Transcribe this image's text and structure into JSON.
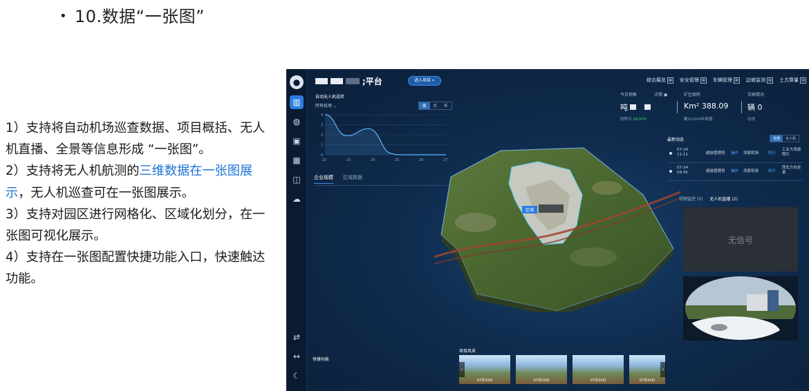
{
  "slide": {
    "title": "10.数据“一张图”",
    "points": [
      "1）支持将自动机场巡查数据、项目概括、无人机直播、全景等信息形成 “一张图”。",
      {
        "before": "2）支持将无人机航测的",
        "highlight": "三维数据在一张图展示",
        "after": "，无人机巡查可在一张图展示。"
      },
      "3）支持对园区进行网格化、区域化划分，在一张图可视化展示。",
      "4）支持在一张图配置快捷功能入口，快速触达功能。"
    ],
    "highlight_color": "#1f74d6"
  },
  "dashboard": {
    "brand_suffix": ";平台",
    "enter_button": "进入项目 »",
    "nav": [
      "综合展览",
      "安全管理",
      "车辆管理",
      "边坡监测",
      "土方算量"
    ],
    "sidebar_icons": [
      "user-icon",
      "chart-icon",
      "globe-icon",
      "image-icon",
      "apps-icon",
      "database-icon",
      "cloud-icon",
      "swap-icon",
      "width-icon",
      "moon-icon"
    ],
    "patrol": {
      "title": "自动无人机巡检",
      "filter": "所有机场",
      "filter_arrow": "⌄",
      "ranges": [
        "周",
        "月",
        "年"
      ],
      "selected_range": "周"
    },
    "chart_data": {
      "type": "area",
      "x": [
        22,
        23,
        24,
        25,
        26,
        27
      ],
      "y_ticks": [
        0,
        1,
        2,
        3,
        4
      ],
      "values": [
        4,
        1.9,
        2.6,
        0.1,
        0,
        0,
        0
      ],
      "x_points": [
        22,
        22.9,
        23.8,
        24.8,
        25,
        26,
        27
      ],
      "ylim": [
        0,
        4
      ],
      "color": "#5bb8ff"
    },
    "tabs": [
      "企业规模",
      "区域数据"
    ],
    "active_tab": "企业规模",
    "stats": {
      "today_sales": {
        "label": "今日销售",
        "detail": "详情",
        "value": "吨",
        "sub_label": "较昨日",
        "sub_value": "-18,670"
      },
      "mine_area": {
        "label": "矿区面积",
        "value": "Km² 388.09",
        "sub": "截止2024年数据"
      },
      "vehicle": {
        "label": "车辆情况",
        "value": "辆 0",
        "sub": "在线"
      }
    },
    "region_label": "区域",
    "feed": {
      "title": "最新动态",
      "tabs": [
        "全部",
        "无人机"
      ],
      "rows": [
        {
          "date": "07-24",
          "time": "11:11",
          "c1": "超级管理员",
          "c2": "操作",
          "c3": "添家机场",
          "c4": "执行",
          "c5": "工业大场景照片"
        },
        {
          "date": "07-24",
          "time": "09:45",
          "c1": "超级管理员",
          "c2": "操作",
          "c3": "添家机场",
          "c4": "执行",
          "c5": "西北方向全景"
        }
      ]
    },
    "video": {
      "tabs": [
        "视频监控 (0)",
        "无人机直播 (2)"
      ],
      "no_signal": "无信号"
    },
    "quick_functions": "快捷功能",
    "project_scenes": {
      "title": "项目风采",
      "captions": [
        "07月24日",
        "07月24日",
        "07月24日",
        "07月24日"
      ]
    }
  }
}
